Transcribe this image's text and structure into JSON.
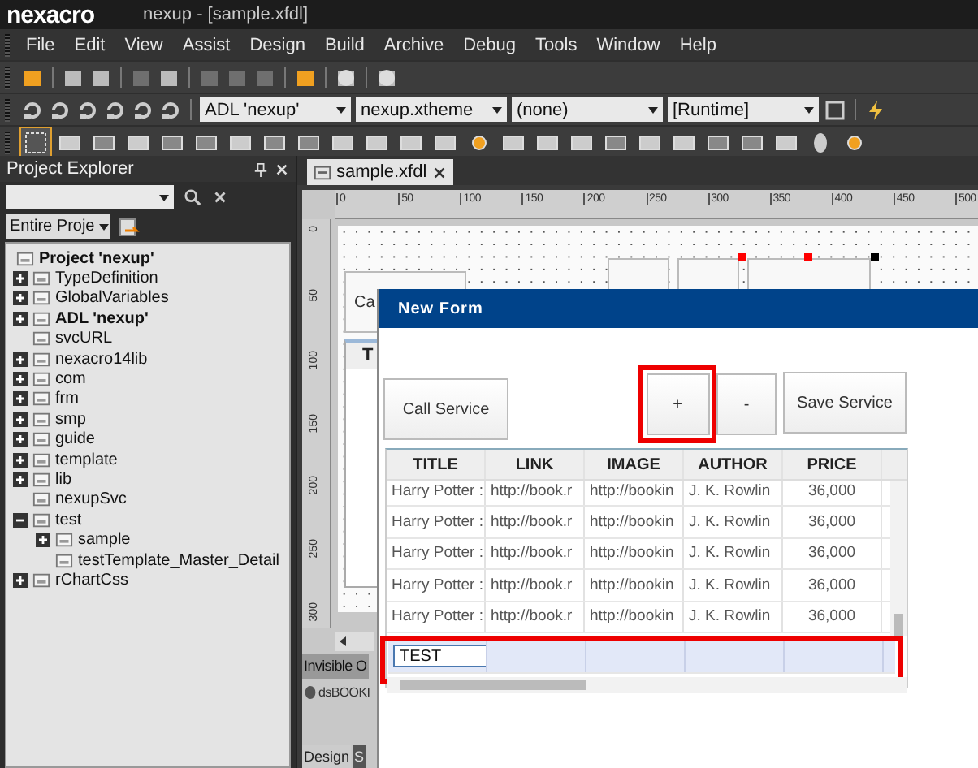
{
  "window": {
    "logo": "nexacro",
    "title": "nexup - [sample.xfdl]"
  },
  "menu": [
    "File",
    "Edit",
    "View",
    "Assist",
    "Design",
    "Build",
    "Archive",
    "Debug",
    "Tools",
    "Window",
    "Help"
  ],
  "toolbar": {
    "combos": [
      "ADL 'nexup'",
      "nexup.xtheme",
      "(none)",
      "[Runtime]"
    ]
  },
  "project_explorer": {
    "title": "Project Explorer",
    "scope": "Entire Proje",
    "tree": [
      {
        "label": "Project 'nexup'",
        "bold": true,
        "children": [
          {
            "label": "TypeDefinition",
            "bold": false,
            "expanded": false
          },
          {
            "label": "GlobalVariables",
            "bold": false,
            "expanded": false
          },
          {
            "label": "ADL 'nexup'",
            "bold": true,
            "expanded": false
          },
          {
            "label": "svcURL",
            "bold": false
          },
          {
            "label": "nexacro14lib",
            "bold": false,
            "expanded": false
          },
          {
            "label": "com",
            "bold": false,
            "expanded": false
          },
          {
            "label": "frm",
            "bold": false,
            "expanded": false
          },
          {
            "label": "smp",
            "bold": false,
            "expanded": false
          },
          {
            "label": "guide",
            "bold": false,
            "expanded": false
          },
          {
            "label": "template",
            "bold": false,
            "expanded": false
          },
          {
            "label": "lib",
            "bold": false,
            "expanded": false
          },
          {
            "label": "nexupSvc",
            "bold": false
          },
          {
            "label": "test",
            "bold": false,
            "expanded": true,
            "children": [
              {
                "label": "sample",
                "bold": false,
                "expanded": false
              },
              {
                "label": "testTemplate_Master_Detail",
                "bold": false
              }
            ]
          },
          {
            "label": "rChartCss",
            "bold": false,
            "expanded": false
          }
        ]
      }
    ]
  },
  "editor": {
    "tab": "sample.xfdl",
    "h_ruler": [
      "0",
      "50",
      "100",
      "150",
      "200",
      "250",
      "300",
      "350",
      "400",
      "450",
      "500"
    ],
    "v_ruler": [
      "0",
      "50",
      "100",
      "150",
      "200",
      "250",
      "300"
    ],
    "canvas_button": "Ca",
    "canvas_grid_header": "T",
    "invisible_panel": "Invisible O",
    "dataset": "dsBOOKI",
    "bottom_tabs": [
      {
        "label": "Design",
        "selected": true
      },
      {
        "label": "S",
        "selected": false
      }
    ]
  },
  "new_form": {
    "title": "New Form",
    "buttons": [
      "Call Service",
      "+",
      "-",
      "Save Service"
    ],
    "grid": {
      "columns": [
        "TITLE",
        "LINK",
        "IMAGE",
        "AUTHOR",
        "PRICE"
      ],
      "rows": [
        [
          "Harry Potter :",
          "http://book.r",
          "http://bookin",
          "J. K. Rowlin",
          "36,000"
        ],
        [
          "Harry Potter :",
          "http://book.r",
          "http://bookin",
          "J. K. Rowlin",
          "36,000"
        ],
        [
          "Harry Potter :",
          "http://book.r",
          "http://bookin",
          "J. K. Rowlin",
          "36,000"
        ],
        [
          "Harry Potter :",
          "http://book.r",
          "http://bookin",
          "J. K. Rowlin",
          "36,000"
        ],
        [
          "Harry Potter :",
          "http://book.r",
          "http://bookin",
          "J. K. Rowlin",
          "36,000"
        ]
      ],
      "new_row": {
        "value": "TEST",
        "selected": true
      }
    }
  }
}
